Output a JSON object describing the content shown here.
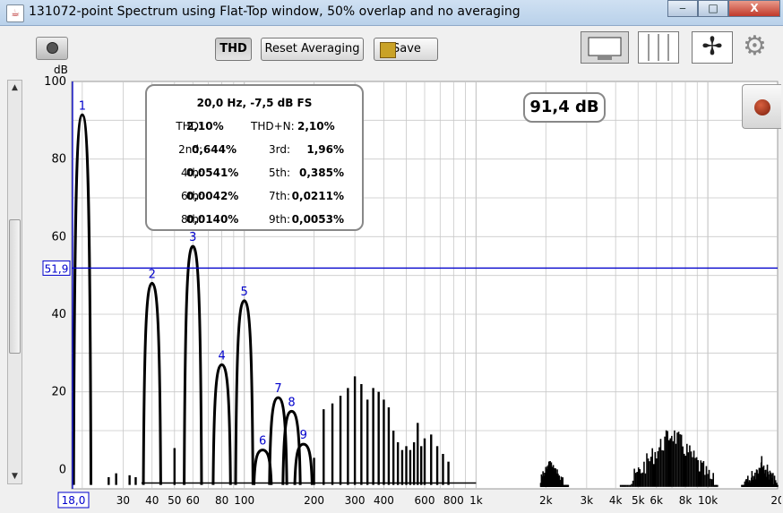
{
  "window": {
    "title": "131072-point Spectrum using Flat-Top window, 50% overlap and no averaging",
    "min_label": "‒",
    "max_label": "□",
    "close_label": "X"
  },
  "toolbar": {
    "thd_label": "THD",
    "reset_label": "Reset Averaging",
    "save_label": "Save"
  },
  "plot": {
    "y_unit": "dB",
    "cursor_y_label": "51,9",
    "cursor_x_label": "18,0",
    "level_display": "91,4 dB"
  },
  "thd_box": {
    "title": "20,0 Hz, -7,5 dB FS",
    "rows": [
      {
        "l1": "THD:",
        "v1": "2,10%",
        "l2": "THD+N:",
        "v2": "2,10%"
      },
      {
        "l1": "2nd:",
        "v1": "0,644%",
        "l2": "3rd:",
        "v2": "1,96%"
      },
      {
        "l1": "4th:",
        "v1": "0,0541%",
        "l2": "5th:",
        "v2": "0,385%"
      },
      {
        "l1": "6th:",
        "v1": "0,0042%",
        "l2": "7th:",
        "v2": "0,0211%"
      },
      {
        "l1": "8th:",
        "v1": "0,0140%",
        "l2": "9th:",
        "v2": "0,0053%"
      }
    ]
  },
  "colors": {
    "accent_blue": "#0000cc",
    "trace": "#000000",
    "grid": "#c8c8c8"
  },
  "chart_data": {
    "type": "line",
    "x_scale": "log",
    "xlim": [
      18,
      20000
    ],
    "ylim": [
      -5,
      100
    ],
    "ylabel": "dB",
    "y_ticks": [
      0,
      20,
      40,
      60,
      80,
      100
    ],
    "x_ticks": [
      {
        "v": 30,
        "label": "30"
      },
      {
        "v": 40,
        "label": "40"
      },
      {
        "v": 50,
        "label": "50"
      },
      {
        "v": 60,
        "label": "60"
      },
      {
        "v": 80,
        "label": "80"
      },
      {
        "v": 100,
        "label": "100"
      },
      {
        "v": 200,
        "label": "200"
      },
      {
        "v": 300,
        "label": "300"
      },
      {
        "v": 400,
        "label": "400"
      },
      {
        "v": 600,
        "label": "600"
      },
      {
        "v": 800,
        "label": "800"
      },
      {
        "v": 1000,
        "label": "1k"
      },
      {
        "v": 2000,
        "label": "2k"
      },
      {
        "v": 3000,
        "label": "3k"
      },
      {
        "v": 4000,
        "label": "4k"
      },
      {
        "v": 5000,
        "label": "5k"
      },
      {
        "v": 6000,
        "label": "6k"
      },
      {
        "v": 8000,
        "label": "8k"
      },
      {
        "v": 10000,
        "label": "10k"
      },
      {
        "v": 20000,
        "label": "20"
      }
    ],
    "cursor": {
      "x": 18,
      "y": 51.9
    },
    "harmonics": [
      {
        "n": "1",
        "f": 20,
        "db": 91.4
      },
      {
        "n": "2",
        "f": 40,
        "db": 48
      },
      {
        "n": "3",
        "f": 60,
        "db": 57.5
      },
      {
        "n": "4",
        "f": 80,
        "db": 27
      },
      {
        "n": "5",
        "f": 100,
        "db": 43.5
      },
      {
        "n": "6",
        "f": 120,
        "db": 5
      },
      {
        "n": "7",
        "f": 140,
        "db": 18.5
      },
      {
        "n": "8",
        "f": 160,
        "db": 15
      },
      {
        "n": "9",
        "f": 180,
        "db": 6.5
      }
    ],
    "spurs": [
      {
        "f": 50,
        "db": 5.5
      },
      {
        "f": 200,
        "db": 3
      },
      {
        "f": 220,
        "db": 15.5
      },
      {
        "f": 240,
        "db": 17
      },
      {
        "f": 260,
        "db": 19
      },
      {
        "f": 280,
        "db": 21
      },
      {
        "f": 300,
        "db": 24
      },
      {
        "f": 320,
        "db": 22
      },
      {
        "f": 340,
        "db": 18
      },
      {
        "f": 360,
        "db": 21
      },
      {
        "f": 380,
        "db": 20
      },
      {
        "f": 400,
        "db": 18
      },
      {
        "f": 420,
        "db": 16
      },
      {
        "f": 440,
        "db": 10
      },
      {
        "f": 460,
        "db": 7
      },
      {
        "f": 480,
        "db": 5
      },
      {
        "f": 500,
        "db": 6
      },
      {
        "f": 520,
        "db": 5
      },
      {
        "f": 540,
        "db": 7
      },
      {
        "f": 560,
        "db": 12
      },
      {
        "f": 580,
        "db": 6
      },
      {
        "f": 600,
        "db": 8
      },
      {
        "f": 640,
        "db": 9
      },
      {
        "f": 680,
        "db": 6
      },
      {
        "f": 720,
        "db": 4
      },
      {
        "f": 760,
        "db": 2
      },
      {
        "f": 26,
        "db": -2
      },
      {
        "f": 28,
        "db": -1
      },
      {
        "f": 32,
        "db": -1.5
      },
      {
        "f": 34,
        "db": -2
      }
    ],
    "noise_clusters": [
      {
        "f_start": 1900,
        "f_end": 2500,
        "peak_db": 3,
        "peak_f": 2100
      },
      {
        "f_start": 4200,
        "f_end": 11000,
        "peak_db": 12,
        "peak_f": 7000
      },
      {
        "f_start": 14000,
        "f_end": 20000,
        "peak_db": 4,
        "peak_f": 17000
      }
    ]
  }
}
